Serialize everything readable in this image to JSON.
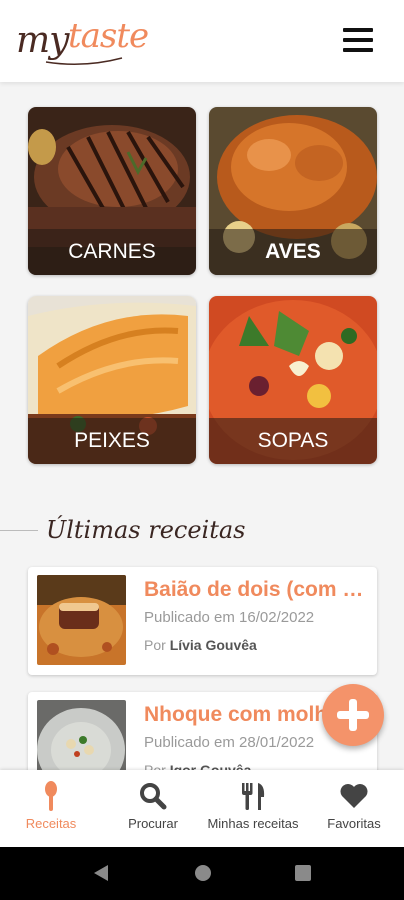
{
  "app": {
    "logo_text": "mytaste",
    "logo_my": "my",
    "logo_taste": "taste",
    "brand_color": "#f08a5d",
    "dark_brown": "#4a2a22"
  },
  "header": {
    "menu_icon": "hamburger-menu-icon"
  },
  "categories": [
    {
      "label": "CARNES",
      "image": "grilled-steak"
    },
    {
      "label": "AVES",
      "image": "roast-chicken"
    },
    {
      "label": "PEIXES",
      "image": "grilled-fish"
    },
    {
      "label": "SOPAS",
      "image": "vegetable-soup"
    }
  ],
  "section": {
    "title": "Últimas receitas"
  },
  "recipes": [
    {
      "title": "Baião de dois (com picanha)",
      "published": "Publicado em 16/02/2022",
      "author_prefix": "Por",
      "author": "Lívia Gouvêa",
      "image": "steak-with-rice-and-beans"
    },
    {
      "title": "Nhoque com molho",
      "published": "Publicado em 28/01/2022",
      "author_prefix": "Por",
      "author": "Igor Gouvêa",
      "image": "gnocchi-plate"
    }
  ],
  "fab": {
    "icon": "plus-icon"
  },
  "bottom_nav": [
    {
      "label": "Receitas",
      "icon": "spoon-icon",
      "active": true
    },
    {
      "label": "Procurar",
      "icon": "search-icon",
      "active": false
    },
    {
      "label": "Minhas receitas",
      "icon": "utensils-icon",
      "active": false
    },
    {
      "label": "Favoritas",
      "icon": "heart-icon",
      "active": false
    }
  ],
  "system_nav": [
    "back-icon",
    "home-icon",
    "recents-icon"
  ]
}
